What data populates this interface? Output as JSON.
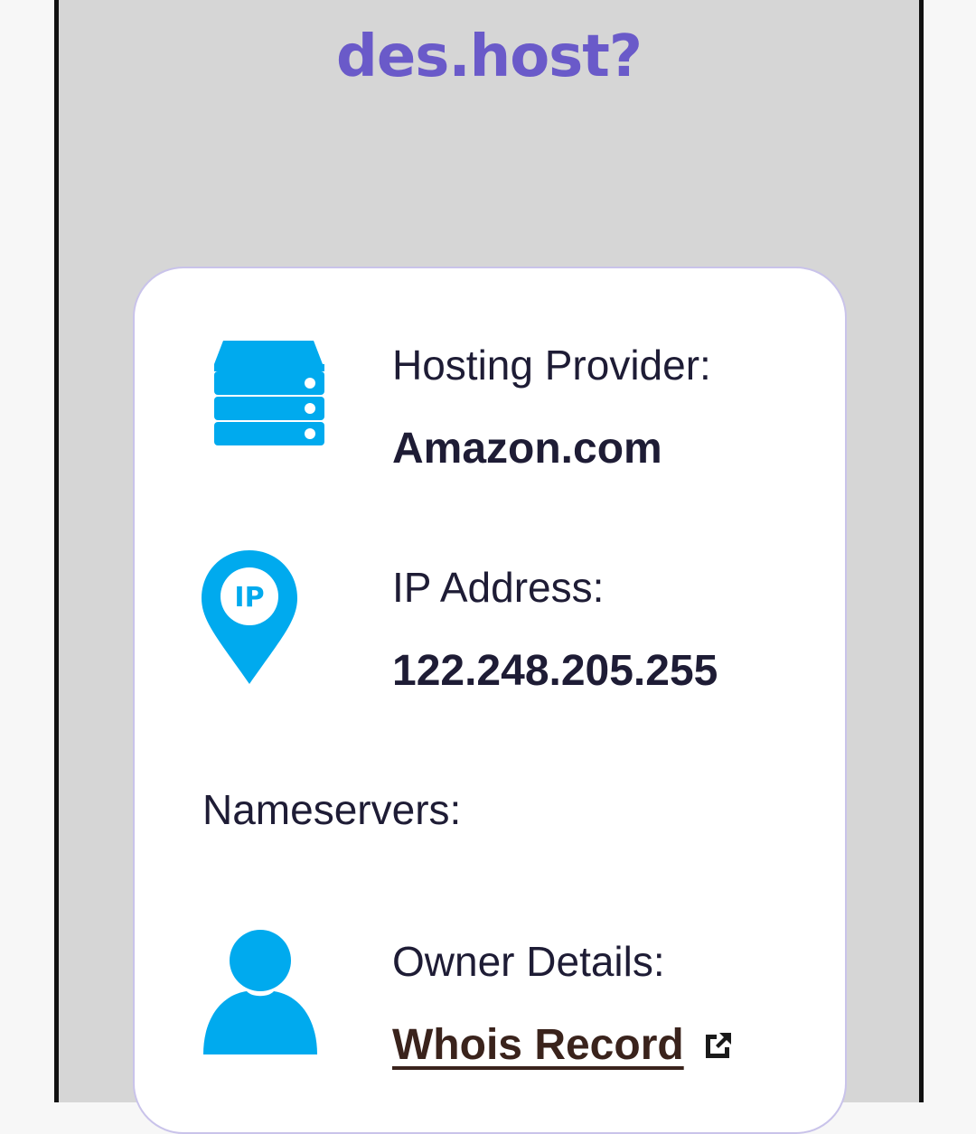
{
  "header": {
    "title": "des.host?"
  },
  "card": {
    "hosting": {
      "label": "Hosting Provider:",
      "value": "Amazon.com",
      "icon": "server-icon"
    },
    "ip": {
      "label": "IP Address:",
      "value": "122.248.205.255",
      "icon": "ip-location-pin-icon",
      "icon_text": "IP"
    },
    "nameservers": {
      "label": "Nameservers:"
    },
    "owner": {
      "label": "Owner Details:",
      "link_text": "Whois Record",
      "icon": "user-icon",
      "link_icon": "external-link-icon"
    }
  },
  "colors": {
    "title": "#6a5ac9",
    "icon_blue": "#00aaee",
    "text": "#1e1c35",
    "link": "#3a231c",
    "frame_bg": "#d6d6d6",
    "card_border": "#c9c3ea"
  }
}
